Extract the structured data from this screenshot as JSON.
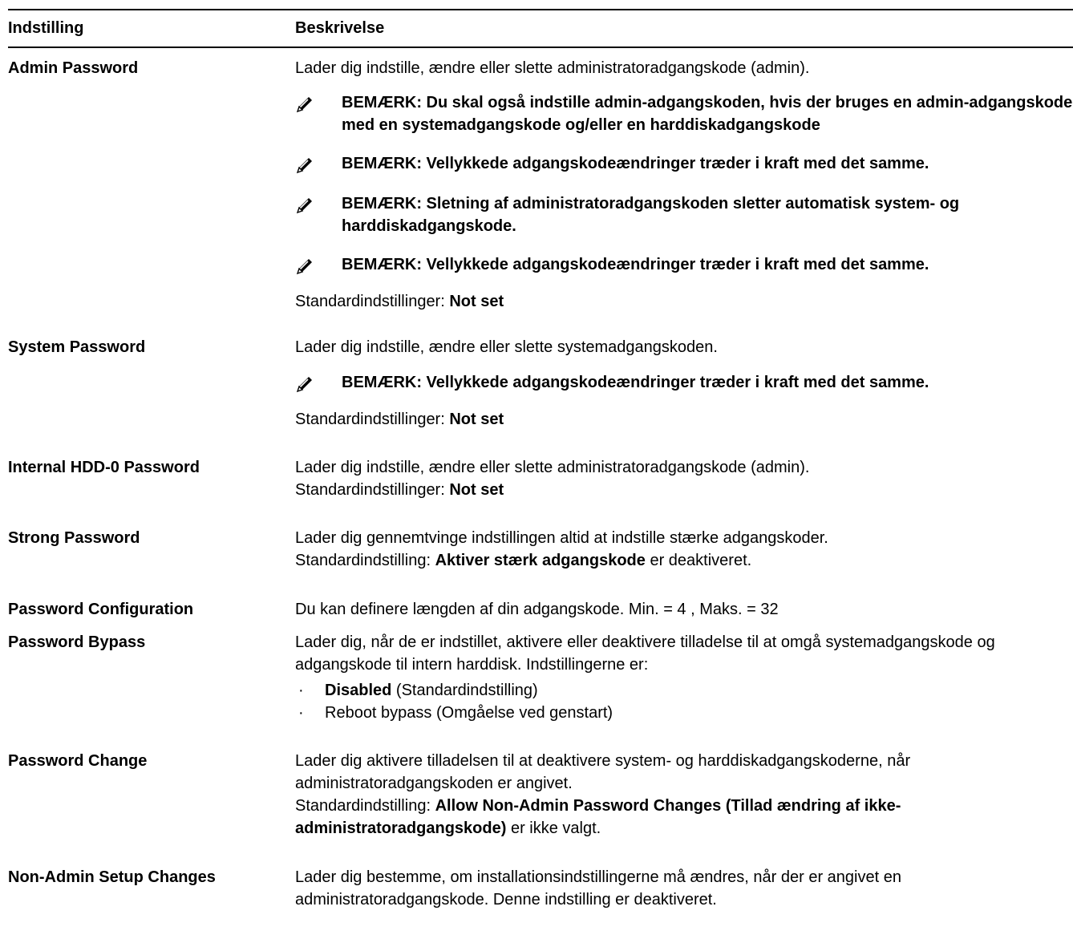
{
  "header": {
    "col1": "Indstilling",
    "col2": "Beskrivelse"
  },
  "rows": {
    "admin": {
      "name": "Admin Password",
      "desc": "Lader dig indstille, ændre eller slette administratoradgangskode (admin).",
      "notes": [
        "BEMÆRK: Du skal også indstille admin-adgangskoden, hvis der bruges en admin-adgangskode med en systemadgangskode og/eller en harddiskadgangskode",
        "BEMÆRK: Vellykkede adgangskodeændringer træder i kraft med det samme.",
        "BEMÆRK: Sletning af administratoradgangskoden sletter automatisk system- og harddiskadgangskode.",
        "BEMÆRK: Vellykkede adgangskodeændringer træder i kraft med det samme."
      ],
      "default_label": "Standardindstillinger: ",
      "default_value": "Not set"
    },
    "system": {
      "name": "System Password",
      "desc": "Lader dig indstille, ændre eller slette systemadgangskoden.",
      "note": "BEMÆRK: Vellykkede adgangskodeændringer træder i kraft med det samme.",
      "default_label": "Standardindstillinger: ",
      "default_value": "Not set"
    },
    "hdd": {
      "name": "Internal HDD-0 Password",
      "desc": "Lader dig indstille, ændre eller slette administratoradgangskode (admin).",
      "default_label": "Standardindstillinger: ",
      "default_value": "Not set"
    },
    "strong": {
      "name": "Strong Password",
      "desc": "Lader dig gennemtvinge indstillingen altid at indstille stærke adgangskoder.",
      "default_label": "Standardindstilling: ",
      "default_value": "Aktiver stærk adgangskode",
      "default_suffix": " er deaktiveret."
    },
    "config": {
      "name": "Password Configuration",
      "desc": "Du kan definere længden af din adgangskode. Min. = 4 , Maks. = 32"
    },
    "bypass": {
      "name": "Password Bypass",
      "desc": "Lader dig, når de er indstillet, aktivere eller deaktivere tilladelse til at omgå systemadgangskode og adgangskode til intern harddisk. Indstillingerne er:",
      "opt1_bold": "Disabled",
      "opt1_rest": " (Standardindstilling)",
      "opt2": "Reboot bypass (Omgåelse ved genstart)"
    },
    "change": {
      "name": "Password Change",
      "desc": "Lader dig aktivere tilladelsen til at deaktivere system- og harddiskadgangskoderne, når administratoradgangskoden er angivet.",
      "default_label": "Standardindstilling: ",
      "default_value": "Allow Non-Admin Password Changes (Tillad ændring af ikke-administratoradgangskode)",
      "default_suffix": " er ikke valgt."
    },
    "nonadmin": {
      "name": "Non-Admin Setup Changes",
      "desc": "Lader dig bestemme, om installationsindstillingerne må ændres, når der er angivet en administratoradgangskode. Denne indstilling er deaktiveret."
    }
  },
  "icons": {
    "note_icon": "pencil-note-icon"
  }
}
